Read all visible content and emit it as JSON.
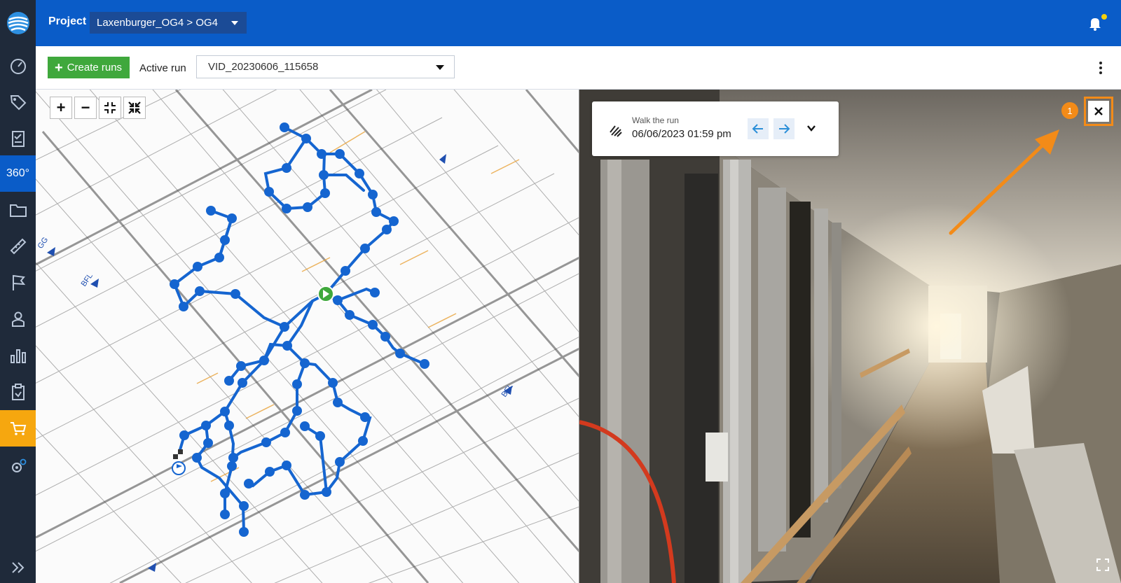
{
  "header": {
    "project_label": "Project",
    "project_path": "Laxenburger_OG4 > OG4"
  },
  "toolbar": {
    "create_runs_label": "Create runs",
    "active_run_label": "Active run",
    "active_run_value": "VID_20230606_115658"
  },
  "sidebar": {
    "items": [
      {
        "name": "dashboard-icon"
      },
      {
        "name": "tag-icon"
      },
      {
        "name": "checklist-icon"
      },
      {
        "name": "360-view",
        "label": "360°"
      },
      {
        "name": "folder-icon"
      },
      {
        "name": "ruler-icon"
      },
      {
        "name": "flag-icon"
      },
      {
        "name": "user-icon"
      },
      {
        "name": "bar-chart-icon"
      },
      {
        "name": "clipboard-icon"
      },
      {
        "name": "cart-icon"
      },
      {
        "name": "settings-icon"
      },
      {
        "name": "expand-icon"
      }
    ]
  },
  "map": {
    "tools": [
      "+",
      "−"
    ]
  },
  "walk": {
    "title": "Walk the run",
    "timestamp": "06/06/2023 01:59 pm"
  },
  "annotation": {
    "badge": "1",
    "accent": "#f38b18"
  },
  "colors": {
    "primary": "#0a5cc8",
    "rail": "#1f2a3a",
    "success": "#3fa83c",
    "shop": "#f6a70f",
    "path": "#1565d0"
  }
}
